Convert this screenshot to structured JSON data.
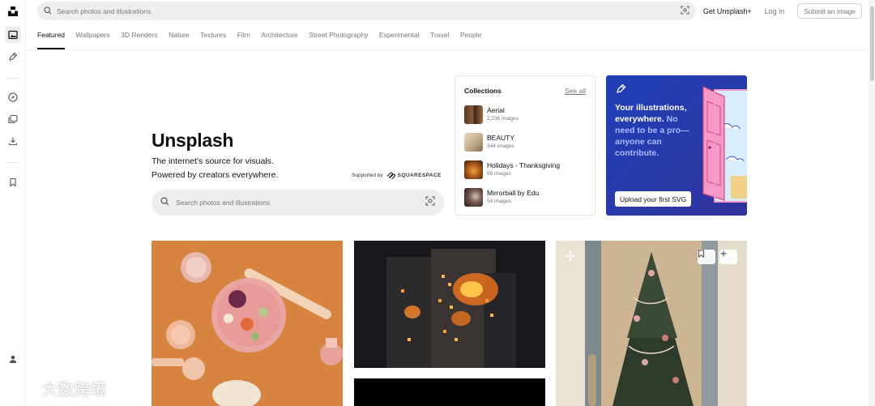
{
  "nav": {
    "search_placeholder": "Search photos and illustrations",
    "get_unsplash_plus": "Get Unsplash+",
    "log_in": "Log in",
    "submit_image": "Submit an image"
  },
  "tabs": [
    {
      "label": "Featured",
      "active": true
    },
    {
      "label": "Wallpapers"
    },
    {
      "label": "3D Renders"
    },
    {
      "label": "Nature"
    },
    {
      "label": "Textures"
    },
    {
      "label": "Film"
    },
    {
      "label": "Architecture"
    },
    {
      "label": "Street Photography"
    },
    {
      "label": "Experimental"
    },
    {
      "label": "Travel"
    },
    {
      "label": "People"
    }
  ],
  "hero": {
    "title": "Unsplash",
    "subtitle_line1": "The internet's source for visuals.",
    "subtitle_line2": "Powered by creators everywhere.",
    "supported_by": "Supported by",
    "sponsor": "SQUARESPACE",
    "search_placeholder": "Search photos and illustrations"
  },
  "collections": {
    "title": "Collections",
    "see_all": "See all",
    "items": [
      {
        "name": "Aerial",
        "count": "2,236 images"
      },
      {
        "name": "BEAUTY",
        "count": "344 images"
      },
      {
        "name": "Holidays - Thanksgiving",
        "count": "99 images"
      },
      {
        "name": "Mirrorball by Edu",
        "count": "54 images"
      }
    ]
  },
  "promo": {
    "line_bold": "Your illustrations, everywhere.",
    "line_dim": "No need to be a pro—anyone can contribute.",
    "cta": "Upload your first SVG"
  },
  "watermark": {
    "text": "大数跨境"
  },
  "colors": {
    "accent_blue": "#2a3aa8",
    "text": "#111111",
    "muted": "#767676",
    "search_bg": "#eeeeee"
  },
  "icons": {
    "logo": "unsplash-logo-icon",
    "photos": "photo-icon",
    "illustrations": "pen-icon",
    "explore": "compass-icon",
    "collections": "folders-icon",
    "downloads": "download-icon",
    "bookmarks": "bookmark-icon",
    "profile": "user-icon",
    "visual_search": "visual-search-icon"
  }
}
